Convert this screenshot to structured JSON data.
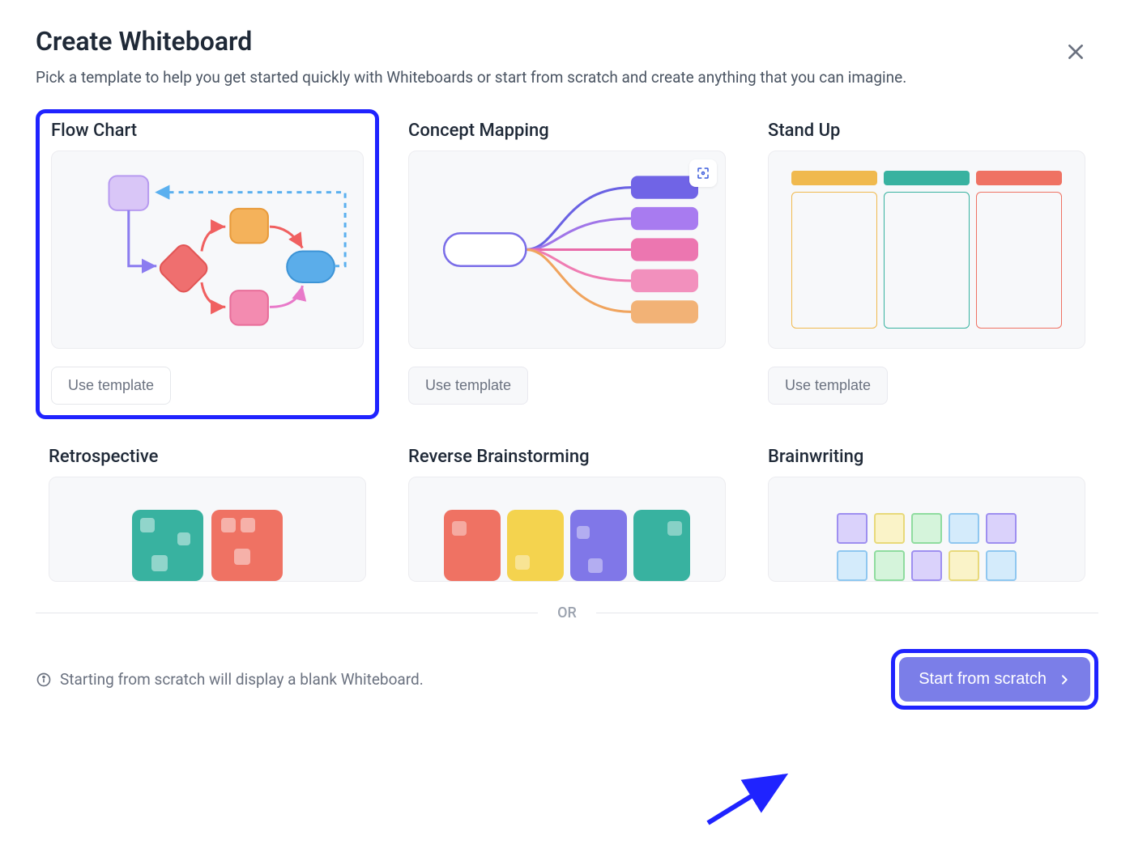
{
  "header": {
    "title": "Create Whiteboard",
    "subtitle": "Pick a template to help you get started quickly with Whiteboards or start from scratch and create anything that you can imagine."
  },
  "buttons": {
    "use_template": "Use template",
    "start_from_scratch": "Start from scratch"
  },
  "separator": {
    "or": "OR"
  },
  "footer": {
    "scratch_info": "Starting from scratch will display a blank Whiteboard."
  },
  "templates": [
    {
      "name": "Flow Chart",
      "selected": true
    },
    {
      "name": "Concept Mapping",
      "selected": false
    },
    {
      "name": "Stand Up",
      "selected": false
    },
    {
      "name": "Retrospective",
      "selected": false
    },
    {
      "name": "Reverse Brainstorming",
      "selected": false
    },
    {
      "name": "Brainwriting",
      "selected": false
    }
  ],
  "icons": {
    "close": "close-icon",
    "info": "info-icon",
    "chevron_right": "chevron-right-icon",
    "expand": "expand-icon"
  },
  "colors": {
    "accent_highlight": "#1f23ff",
    "primary_button": "#7b7ee8"
  }
}
